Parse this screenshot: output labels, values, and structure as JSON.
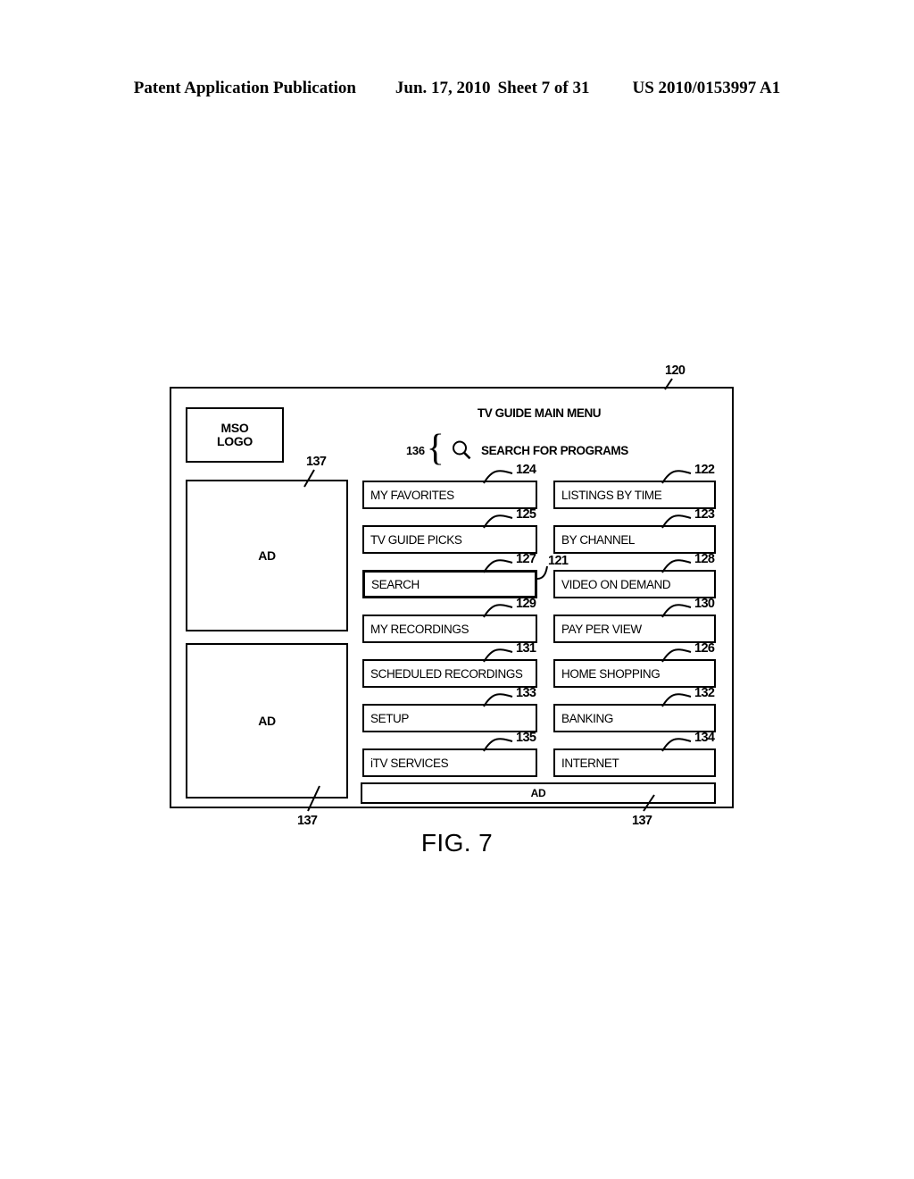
{
  "header": {
    "publication": "Patent Application Publication",
    "date": "Jun. 17, 2010",
    "sheet": "Sheet 7 of 31",
    "patent_number": "US 2010/0153997 A1"
  },
  "figure": {
    "caption": "FIG. 7",
    "screen_ref": "120",
    "title": "TV GUIDE MAIN MENU"
  },
  "sidebar": {
    "logo_line1": "MSO",
    "logo_line2": "LOGO",
    "ad_label": "AD",
    "ad_top_ref": "137",
    "ad_bottom_ref": "137"
  },
  "search": {
    "ref": "136",
    "brace": "{",
    "icon": "magnifier-icon",
    "caption": "SEARCH FOR PROGRAMS"
  },
  "menu": {
    "left_column": [
      {
        "label": "MY FAVORITES",
        "ref": "124",
        "highlighted": false
      },
      {
        "label": "TV GUIDE PICKS",
        "ref": "125",
        "highlighted": false
      },
      {
        "label": "SEARCH",
        "ref": "127",
        "highlighted": true
      },
      {
        "label": "MY RECORDINGS",
        "ref": "129",
        "highlighted": false
      },
      {
        "label": "SCHEDULED RECORDINGS",
        "ref": "131",
        "highlighted": false
      },
      {
        "label": "SETUP",
        "ref": "133",
        "highlighted": false
      },
      {
        "label": "iTV SERVICES",
        "ref": "135",
        "highlighted": false
      }
    ],
    "right_column": [
      {
        "label": "LISTINGS BY  TIME",
        "ref": "122",
        "highlighted": false
      },
      {
        "label": "BY CHANNEL",
        "ref": "123",
        "highlighted": false
      },
      {
        "label": "VIDEO ON DEMAND",
        "ref": "128",
        "highlighted": false
      },
      {
        "label": "PAY PER VIEW",
        "ref": "130",
        "highlighted": false
      },
      {
        "label": "HOME SHOPPING",
        "ref": "126",
        "highlighted": false
      },
      {
        "label": "BANKING",
        "ref": "132",
        "highlighted": false
      },
      {
        "label": "INTERNET",
        "ref": "134",
        "highlighted": false
      }
    ],
    "group_ref": "121"
  },
  "ad_banner": {
    "label": "AD",
    "ref": "137"
  }
}
